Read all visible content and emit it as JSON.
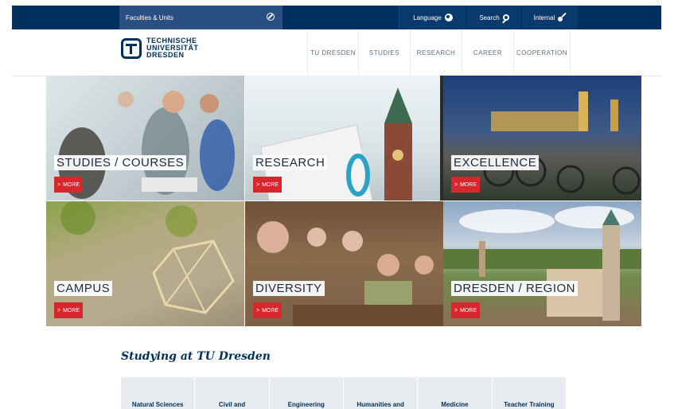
{
  "topbar": {
    "faculties_label": "Faculties & Units",
    "language_label": "Language",
    "search_label": "Search",
    "internal_label": "Internal"
  },
  "logo": {
    "line1": "TECHNISCHE",
    "line2": "UNIVERSITÄT",
    "line3": "DRESDEN"
  },
  "nav": [
    {
      "label": "TU DRESDEN"
    },
    {
      "label": "STUDIES"
    },
    {
      "label": "RESEARCH"
    },
    {
      "label": "CAREER"
    },
    {
      "label": "COOPERATION"
    }
  ],
  "tiles": [
    {
      "label": "STUDIES / COURSES",
      "more": "MORE"
    },
    {
      "label": "RESEARCH",
      "more": "MORE"
    },
    {
      "label": "EXCELLENCE",
      "more": "MORE"
    },
    {
      "label": "CAMPUS",
      "more": "MORE"
    },
    {
      "label": "DIVERSITY",
      "more": "MORE"
    },
    {
      "label": "DRESDEN / REGION",
      "more": "MORE"
    }
  ],
  "studying": {
    "heading": "Studying at TU Dresden",
    "categories": [
      {
        "label": "Natural Sciences"
      },
      {
        "label": "Civil and"
      },
      {
        "label": "Engineering"
      },
      {
        "label": "Humanities and"
      },
      {
        "label": "Medicine"
      },
      {
        "label": "Teacher Training"
      }
    ]
  },
  "colors": {
    "topbar": "#00305e",
    "accent_red": "#d7262c",
    "brand_blue": "#00305e"
  }
}
